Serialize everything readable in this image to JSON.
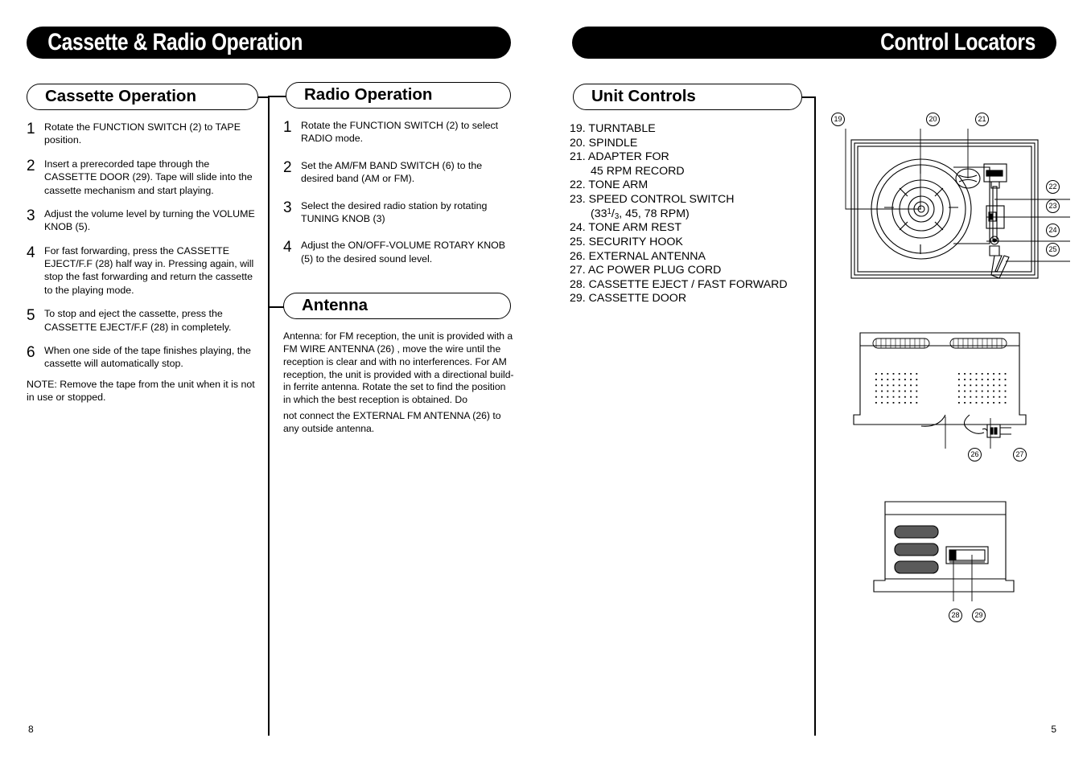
{
  "banners": {
    "left": "Cassette & Radio Operation",
    "right": "Control Locators"
  },
  "sections": {
    "cassette_operation": "Cassette Operation",
    "radio_operation": "Radio Operation",
    "antenna": "Antenna",
    "unit_controls": "Unit Controls"
  },
  "cassette_steps": [
    {
      "num": "1",
      "text": "Rotate the FUNCTION SWITCH (2) to TAPE position."
    },
    {
      "num": "2",
      "text": "Insert a prerecorded tape through the CASSETTE DOOR (29). Tape will slide into the cassette mechanism and start playing."
    },
    {
      "num": "3",
      "text": "Adjust the volume level by turning the VOLUME KNOB (5)."
    },
    {
      "num": "4",
      "text": "For fast forwarding, press the CASSETTE EJECT/F.F (28) half way in. Pressing again, will stop the fast forwarding and return the cassette to the playing mode."
    },
    {
      "num": "5",
      "text": "To stop and eject the cassette, press the CASSETTE EJECT/F.F (28) in completely."
    },
    {
      "num": "6",
      "text": "When one side of the tape finishes playing, the cassette will automatically stop."
    }
  ],
  "cassette_note": "NOTE: Remove the tape from the unit when it is not in use or stopped.",
  "radio_steps": [
    {
      "num": "1",
      "text": "Rotate the FUNCTION SWITCH (2) to select RADIO mode."
    },
    {
      "num": "2",
      "text": "Set the AM/FM BAND SWITCH (6) to the desired band (AM or FM)."
    },
    {
      "num": "3",
      "text": "Select the desired radio station by rotating TUNING KNOB (3)"
    },
    {
      "num": "4",
      "text": "Adjust the ON/OFF-VOLUME ROTARY KNOB (5) to the desired sound level."
    }
  ],
  "antenna_text": [
    "Antenna: for FM reception, the unit is provided with a FM WIRE ANTENNA (26) , move the wire until the reception is clear and with no interferences. For AM reception, the unit is provided with a directional build-in ferrite antenna. Rotate the set to find the position in which the best reception is obtained. Do",
    "not connect the EXTERNAL FM ANTENNA (26) to any outside antenna."
  ],
  "unit_controls": [
    {
      "text": "19. TURNTABLE",
      "cont": false
    },
    {
      "text": "20. SPINDLE",
      "cont": false
    },
    {
      "text": "21. ADAPTER FOR",
      "cont": false
    },
    {
      "text": "45 RPM RECORD",
      "cont": true
    },
    {
      "text": "22. TONE ARM",
      "cont": false
    },
    {
      "text": "23. SPEED CONTROL SWITCH",
      "cont": false
    },
    {
      "html": "(33<sup>1</sup>/<sub>3</sub>, 45, 78 RPM)",
      "cont": true
    },
    {
      "text": "24. TONE ARM REST",
      "cont": false
    },
    {
      "text": "25. SECURITY HOOK",
      "cont": false
    },
    {
      "text": "26. EXTERNAL ANTENNA",
      "cont": false
    },
    {
      "text": "27. AC POWER PLUG CORD",
      "cont": false
    },
    {
      "text": "28. CASSETTE EJECT / FAST FORWARD",
      "cont": false
    },
    {
      "text": "29. CASSETTE DOOR",
      "cont": false
    }
  ],
  "callouts": {
    "c19": "19",
    "c20": "20",
    "c21": "21",
    "c22": "22",
    "c23": "23",
    "c24": "24",
    "c25": "25",
    "c26": "26",
    "c27": "27",
    "c28": "28",
    "c29": "29"
  },
  "page_numbers": {
    "left": "8",
    "right": "5"
  },
  "colors": {
    "ink": "#000000",
    "paper": "#ffffff",
    "shade": "#4a4a4a"
  }
}
